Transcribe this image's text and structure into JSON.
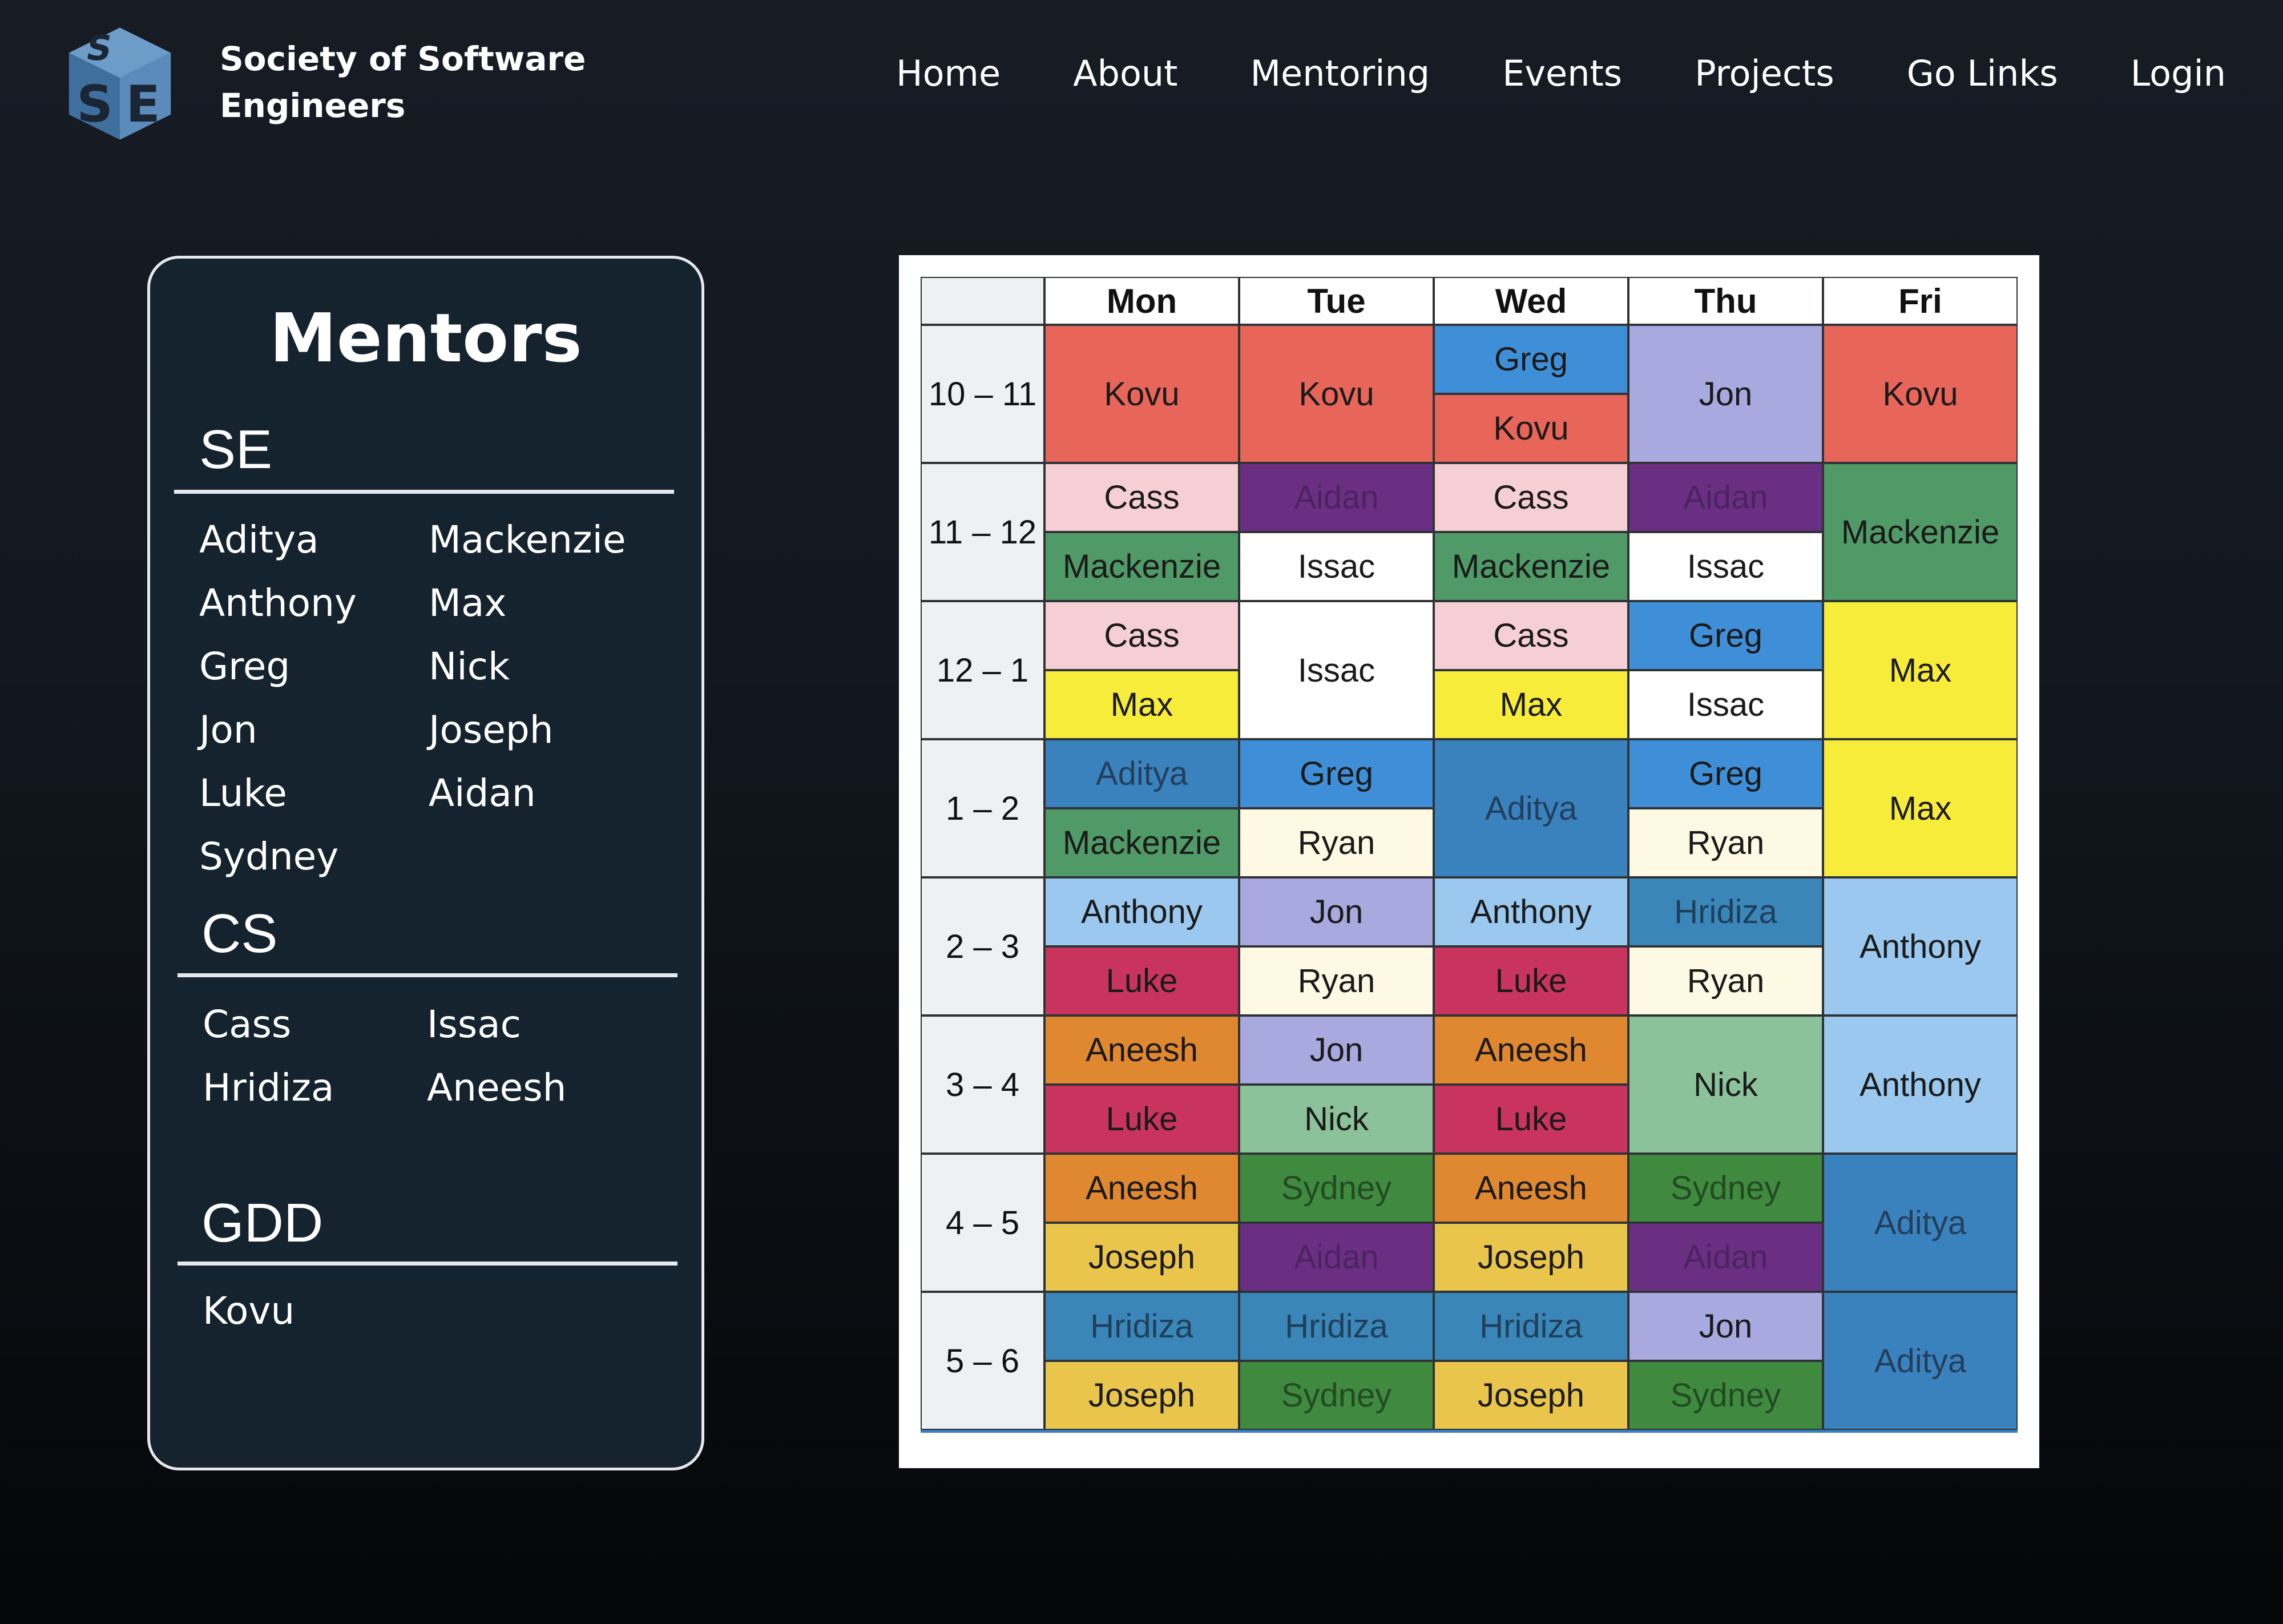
{
  "header": {
    "brand_line1": "Society of Software",
    "brand_line2": "Engineers",
    "logo_icon": "sse-cube-logo",
    "nav": [
      "Home",
      "About",
      "Mentoring",
      "Events",
      "Projects",
      "Go Links",
      "Login"
    ]
  },
  "mentors": {
    "title": "Mentors",
    "sections": [
      {
        "title": "SE",
        "names": [
          "Aditya",
          "Mackenzie",
          "Anthony",
          "Max",
          "Greg",
          "Nick",
          "Jon",
          "Joseph",
          "Luke",
          "Aidan",
          "Sydney"
        ]
      },
      {
        "title": "CS",
        "names": [
          "Cass",
          "Issac",
          "Hridiza",
          "Aneesh"
        ]
      },
      {
        "title": "GDD",
        "names": [
          "Kovu"
        ]
      }
    ]
  },
  "schedule": {
    "days": [
      "Mon",
      "Tue",
      "Wed",
      "Thu",
      "Fri"
    ],
    "times": [
      "10 – 11",
      "11 – 12",
      "12 – 1",
      "1 – 2",
      "2 – 3",
      "3 – 4",
      "4 – 5",
      "5 – 6"
    ],
    "colors": {
      "Kovu": "#e8655a",
      "Greg": "#3f8fd8",
      "Jon": "#a8a9df",
      "Cass": "#f6cfd4",
      "Aidan": "#6a2f82",
      "Mackenzie": "#4f9a66",
      "Issac": "#ffffff",
      "Max": "#f7ec3a",
      "Aditya": "#3a82be",
      "Ryan": "#fdf9e2",
      "Anthony": "#9ac8ef",
      "Hridiza": "#3a86b8",
      "Luke": "#c9345f",
      "Aneesh": "#e0882f",
      "Nick": "#8cc29a",
      "Sydney": "#3f8a3f",
      "Joseph": "#e9c54c"
    },
    "columns": [
      [
        [
          "Kovu",
          2
        ],
        [
          "Cass",
          1
        ],
        [
          "Mackenzie",
          1
        ],
        [
          "Cass",
          1
        ],
        [
          "Max",
          1
        ],
        [
          "Aditya",
          1
        ],
        [
          "Mackenzie",
          1
        ],
        [
          "Anthony",
          1
        ],
        [
          "Luke",
          1
        ],
        [
          "Aneesh",
          1
        ],
        [
          "Luke",
          1
        ],
        [
          "Aneesh",
          1
        ],
        [
          "Joseph",
          1
        ],
        [
          "Hridiza",
          1
        ],
        [
          "Joseph",
          1
        ]
      ],
      [
        [
          "Kovu",
          2
        ],
        [
          "Aidan",
          1
        ],
        [
          "Issac",
          1
        ],
        [
          "Issac",
          2
        ],
        [
          "Greg",
          1
        ],
        [
          "Ryan",
          1
        ],
        [
          "Jon",
          1
        ],
        [
          "Ryan",
          1
        ],
        [
          "Jon",
          1
        ],
        [
          "Nick",
          1
        ],
        [
          "Sydney",
          1
        ],
        [
          "Aidan",
          1
        ],
        [
          "Hridiza",
          1
        ],
        [
          "Sydney",
          1
        ]
      ],
      [
        [
          "Greg",
          1
        ],
        [
          "Kovu",
          1
        ],
        [
          "Cass",
          1
        ],
        [
          "Mackenzie",
          1
        ],
        [
          "Cass",
          1
        ],
        [
          "Max",
          1
        ],
        [
          "Aditya",
          2
        ],
        [
          "Anthony",
          1
        ],
        [
          "Luke",
          1
        ],
        [
          "Aneesh",
          1
        ],
        [
          "Luke",
          1
        ],
        [
          "Aneesh",
          1
        ],
        [
          "Joseph",
          1
        ],
        [
          "Hridiza",
          1
        ],
        [
          "Joseph",
          1
        ]
      ],
      [
        [
          "Jon",
          2
        ],
        [
          "Aidan",
          1
        ],
        [
          "Issac",
          1
        ],
        [
          "Greg",
          1
        ],
        [
          "Issac",
          1
        ],
        [
          "Greg",
          1
        ],
        [
          "Ryan",
          1
        ],
        [
          "Hridiza",
          1
        ],
        [
          "Ryan",
          1
        ],
        [
          "Nick",
          2
        ],
        [
          "Sydney",
          1
        ],
        [
          "Aidan",
          1
        ],
        [
          "Jon",
          1
        ],
        [
          "Sydney",
          1
        ]
      ],
      [
        [
          "Kovu",
          2
        ],
        [
          "Mackenzie",
          2
        ],
        [
          "Max",
          2
        ],
        [
          "Max",
          2
        ],
        [
          "Anthony",
          2
        ],
        [
          "Anthony",
          2
        ],
        [
          "Aditya",
          2
        ],
        [
          "Aditya",
          2
        ]
      ]
    ]
  }
}
